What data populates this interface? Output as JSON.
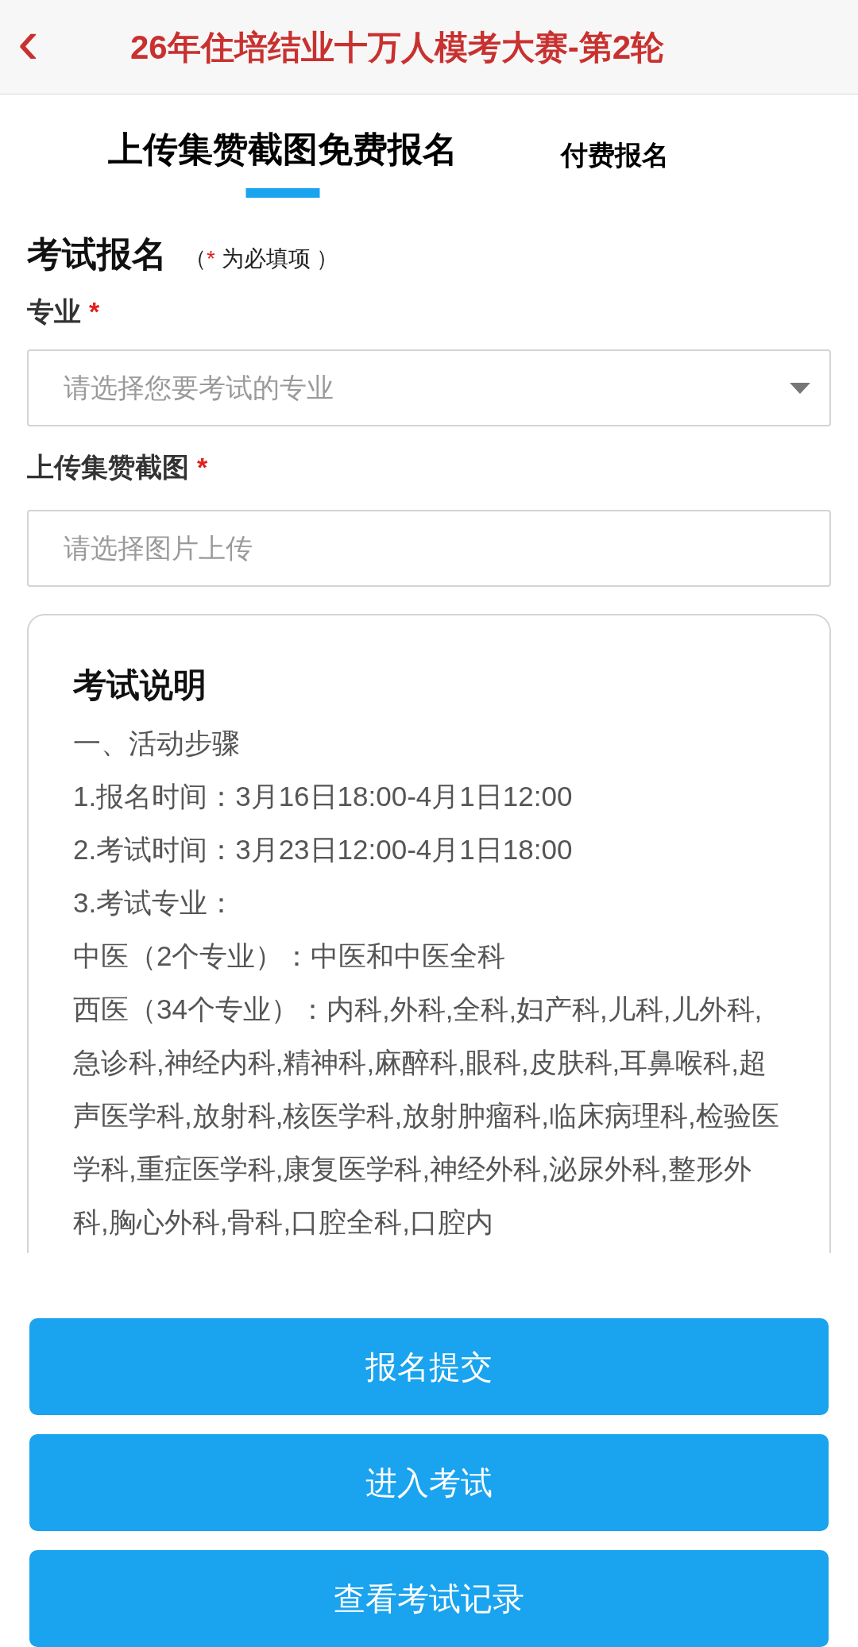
{
  "header": {
    "back": "‹",
    "title": "26年住培结业十万人模考大赛-第2轮"
  },
  "tabs": [
    {
      "label": "上传集赞截图免费报名",
      "selected": true
    },
    {
      "label": "付费报名",
      "selected": false
    }
  ],
  "form": {
    "title": "考试报名",
    "note_open": "（",
    "note_star": "*",
    "note_text": "为必填项",
    "note_close": "）",
    "fields": [
      {
        "label": "专业",
        "required": true,
        "kind": "select",
        "placeholder": "请选择您要考试的专业"
      },
      {
        "label": "上传集赞截图",
        "required": true,
        "kind": "upload",
        "placeholder": "请选择图片上传"
      }
    ]
  },
  "info": {
    "title": "考试说明",
    "lines": [
      "一、活动步骤",
      "1.报名时间：3月16日18:00-4月1日12:00",
      "2.考试时间：3月23日12:00-4月1日18:00",
      "3.考试专业：",
      "中医（2个专业）：中医和中医全科",
      "西医（34个专业）：内科,外科,全科,妇产科,儿科,儿外科,急诊科,神经内科,精神科,麻醉科,眼科,皮肤科,耳鼻喉科,超声医学科,放射科,核医学科,放射肿瘤科,临床病理科,检验医学科,重症医学科,康复医学科,神经外科,泌尿外科,整形外科,胸心外科,骨科,口腔全科,口腔内"
    ]
  },
  "buttons": [
    "报名提交",
    "进入考试",
    "查看考试记录"
  ]
}
